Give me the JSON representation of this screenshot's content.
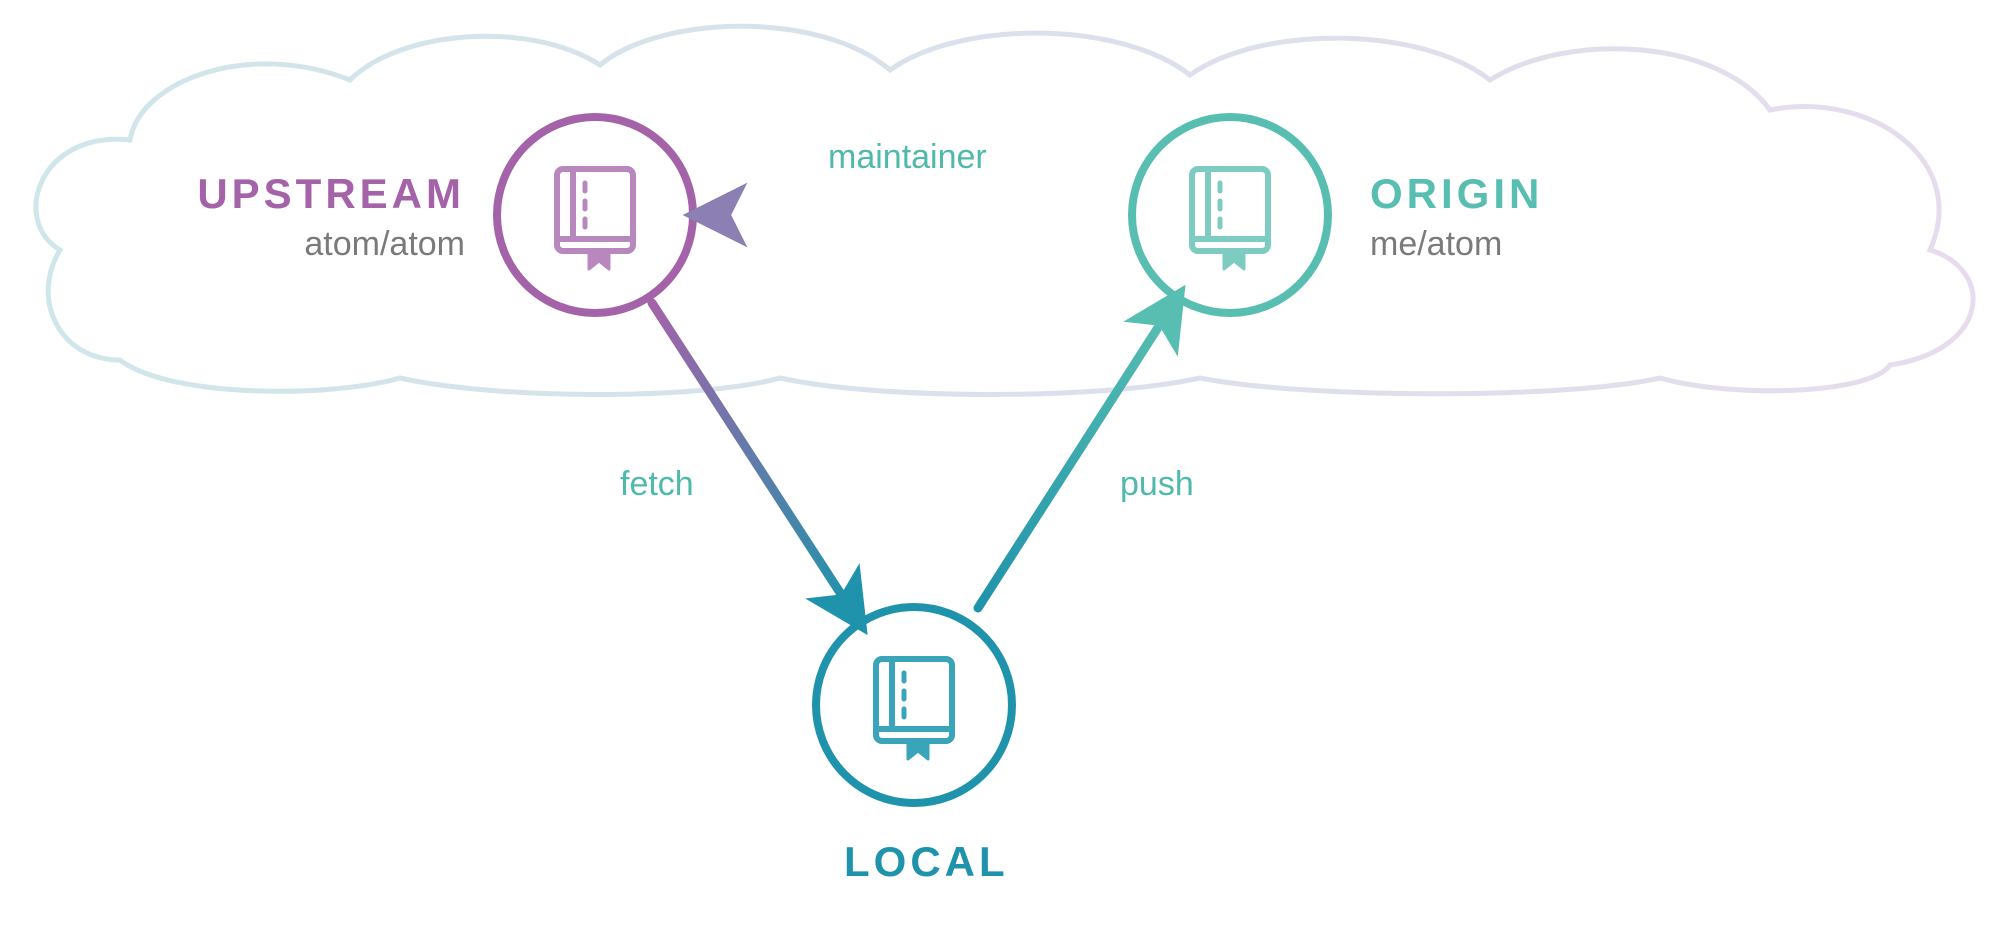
{
  "nodes": {
    "upstream": {
      "title": "UPSTREAM",
      "subtitle": "atom/atom",
      "color": "#a463a8"
    },
    "origin": {
      "title": "ORIGIN",
      "subtitle": "me/atom",
      "color": "#58beb1"
    },
    "local": {
      "title": "LOCAL",
      "color": "#1f93ab"
    }
  },
  "edges": {
    "maintainer": {
      "label": "maintainer"
    },
    "fetch": {
      "label": "fetch"
    },
    "push": {
      "label": "push"
    }
  },
  "colors": {
    "purple": "#a463a8",
    "teal": "#58beb1",
    "blue": "#1f93ab",
    "gray": "#7a7a7a",
    "cloudLeft": "#cfe6ea",
    "cloudRight": "#e6dced"
  }
}
